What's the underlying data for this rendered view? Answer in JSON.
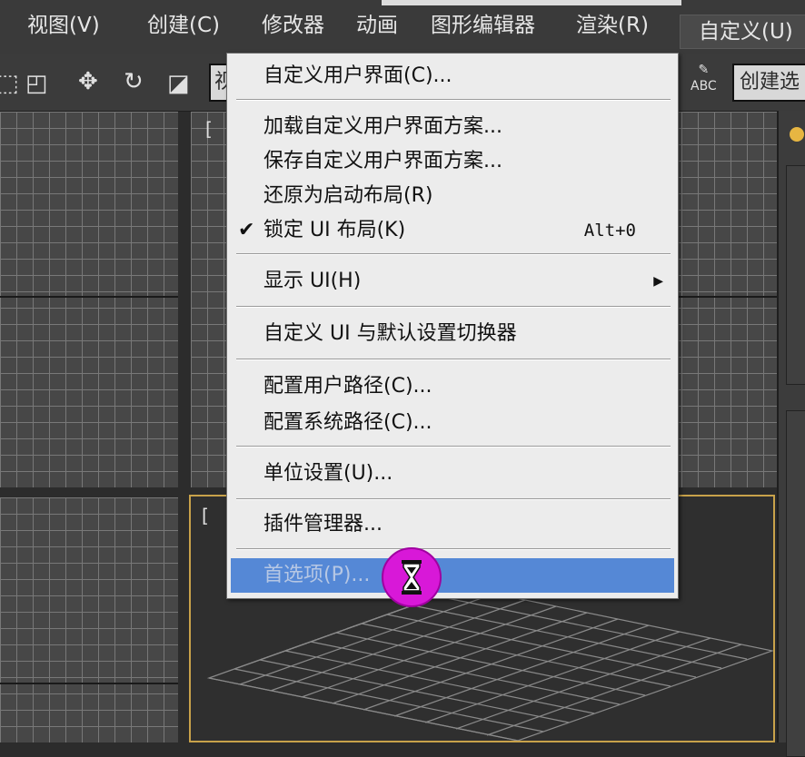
{
  "menubar": {
    "items": [
      {
        "label": "视图(V)"
      },
      {
        "label": "创建(C)"
      },
      {
        "label": "修改器"
      },
      {
        "label": "动画"
      },
      {
        "label": "图形编辑器"
      },
      {
        "label": "渲染(R)"
      },
      {
        "label": "自定义(U)"
      }
    ]
  },
  "toolbar": {
    "field_left": "视",
    "spell_icon": "abc-spell-icon",
    "field_right": "创建选"
  },
  "viewport": {
    "label_topright": "[",
    "label_perspective": "["
  },
  "dropdown": {
    "items": [
      {
        "label": "自定义用户界面(C)..."
      },
      {
        "label": "加载自定义用户界面方案..."
      },
      {
        "label": "保存自定义用户界面方案..."
      },
      {
        "label": "还原为启动布局(R)"
      },
      {
        "label": "锁定 UI 布局(K)",
        "checked": true,
        "shortcut": "Alt+0"
      },
      {
        "label": "显示 UI(H)",
        "submenu": true
      },
      {
        "label": "自定义 UI 与默认设置切换器"
      },
      {
        "label": "配置用户路径(C)..."
      },
      {
        "label": "配置系统路径(C)..."
      },
      {
        "label": "单位设置(U)..."
      },
      {
        "label": "插件管理器..."
      },
      {
        "label": "首选项(P)...",
        "highlighted": true
      }
    ],
    "check_glyph": "✔",
    "submenu_glyph": "▶"
  },
  "cursor": {
    "icon": "hourglass-icon"
  },
  "colors": {
    "highlight": "#5588d6",
    "cursor_ring": "#d818d8",
    "viewport_border": "#c8a24a"
  }
}
